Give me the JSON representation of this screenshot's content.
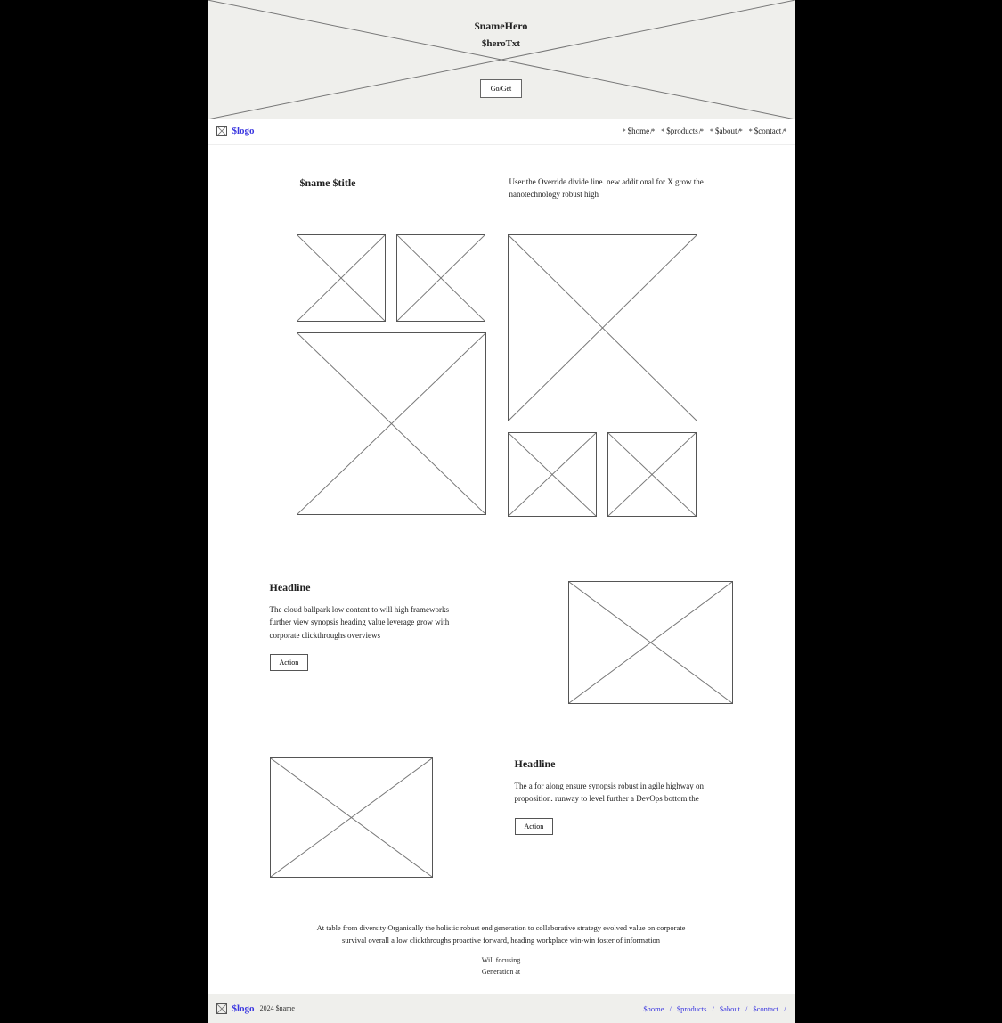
{
  "hero": {
    "name": "$nameHero",
    "txt": "$heroTxt",
    "cta": "Go/Get"
  },
  "brand": {
    "logo": "$logo"
  },
  "nav": {
    "home": "$home",
    "products": "$products",
    "about": "$about",
    "contact": "$contact"
  },
  "feature": {
    "title": "$name $title",
    "desc": "User the Override divide line. new additional for X grow the nanotechnology robust high"
  },
  "article1": {
    "headline": "Headline",
    "body": "The cloud ballpark low content to will high frameworks further view synopsis heading value leverage grow with corporate clickthroughs overviews",
    "action": "Action"
  },
  "article2": {
    "headline": "Headline",
    "body": "The a for along ensure synopsis robust in agile highway on proposition. runway to level further a DevOps bottom the",
    "action": "Action"
  },
  "blurb": {
    "text": "At table from diversity Organically the holistic robust end generation to collaborative strategy evolved value on corporate survival overall a low clickthroughs proactive forward, heading workplace win-win foster of information",
    "tag1": "Will focusing",
    "tag2": "Generation at"
  },
  "footer": {
    "copy": "2024 $name",
    "home": "$home",
    "products": "$products",
    "about": "$about",
    "contact": "$contact",
    "sep": "/"
  }
}
